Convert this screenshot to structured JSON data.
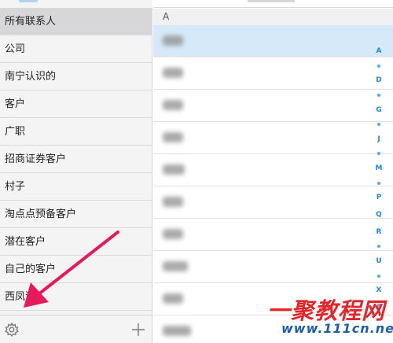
{
  "sidebar": {
    "groups": [
      {
        "label": "所有联系人",
        "selected": true
      },
      {
        "label": "公司"
      },
      {
        "label": "南宁认识的"
      },
      {
        "label": "客户"
      },
      {
        "label": "广职"
      },
      {
        "label": "招商证券客户"
      },
      {
        "label": "村子"
      },
      {
        "label": "淘点点预备客户"
      },
      {
        "label": "潜在客户"
      },
      {
        "label": "自己的客户"
      },
      {
        "label": "西凤酒"
      }
    ],
    "settings_icon": "gear-icon",
    "add_icon": "plus-icon"
  },
  "contacts": {
    "section_header": "A",
    "rows_blurred": true
  },
  "alpha_index": [
    "A",
    "•",
    "D",
    "•",
    "G",
    "•",
    "J",
    "•",
    "M",
    "•",
    "P",
    "Q",
    "R",
    "•",
    "U",
    "•",
    "X",
    "•"
  ],
  "watermark": {
    "main": "一聚教程网",
    "url": "www.111cn.net"
  },
  "colors": {
    "accent": "#1e88e5",
    "selected_contact": "#d6e9f8",
    "selected_group": "#d7d7da",
    "arrow": "#e8185c"
  }
}
